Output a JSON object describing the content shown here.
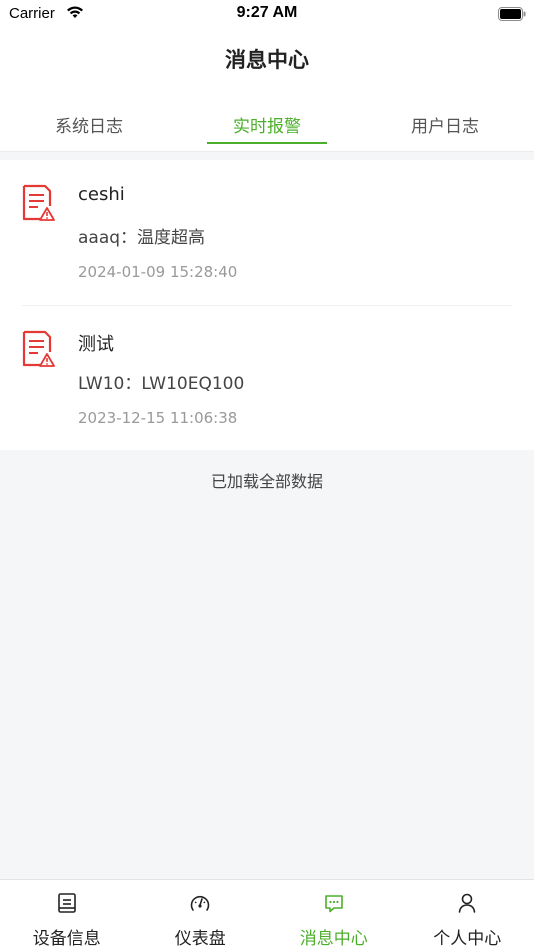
{
  "status_bar": {
    "carrier": "Carrier",
    "time": "9:27 AM"
  },
  "nav": {
    "title": "消息中心"
  },
  "tabs": [
    {
      "label": "系统日志",
      "active": false
    },
    {
      "label": "实时报警",
      "active": true
    },
    {
      "label": "用户日志",
      "active": false
    }
  ],
  "messages": [
    {
      "title": "ceshi",
      "body": "aaaq：温度超高",
      "time": "2024-01-09 15:28:40",
      "icon": "alarm-document-icon"
    },
    {
      "title": "测试",
      "body": "LW10：LW10EQ100",
      "time": "2023-12-15 11:06:38",
      "icon": "alarm-document-icon"
    }
  ],
  "footer_text": "已加载全部数据",
  "tabbar": [
    {
      "label": "设备信息",
      "icon": "device-list-icon",
      "active": false
    },
    {
      "label": "仪表盘",
      "icon": "gauge-icon",
      "active": false
    },
    {
      "label": "消息中心",
      "icon": "message-icon",
      "active": true
    },
    {
      "label": "个人中心",
      "icon": "user-icon",
      "active": false
    }
  ],
  "colors": {
    "accent": "#4caf2a",
    "alarm": "#e53935"
  }
}
